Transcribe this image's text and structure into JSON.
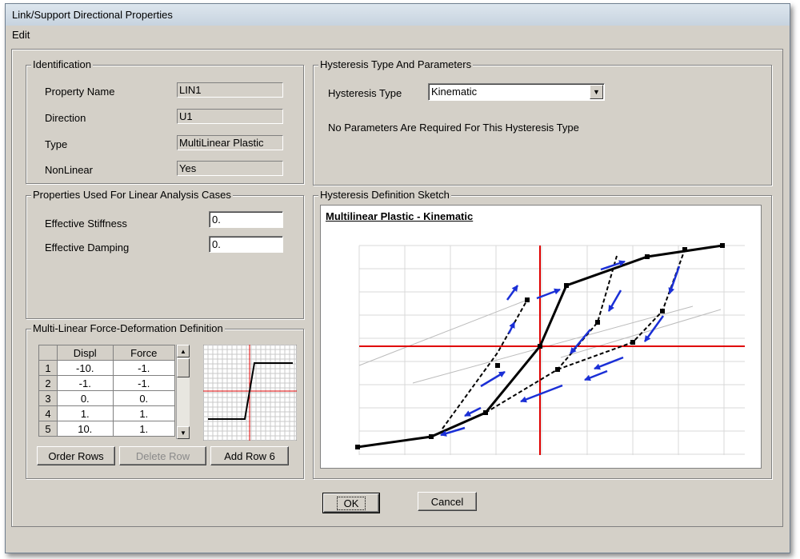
{
  "window": {
    "title": "Link/Support Directional Properties"
  },
  "menu": {
    "items": [
      "Edit"
    ]
  },
  "identification": {
    "title": "Identification",
    "property_name_label": "Property Name",
    "property_name": "LIN1",
    "direction_label": "Direction",
    "direction": "U1",
    "type_label": "Type",
    "type": "MultiLinear Plastic",
    "nonlinear_label": "NonLinear",
    "nonlinear": "Yes"
  },
  "linear": {
    "title": "Properties Used For Linear Analysis Cases",
    "stiffness_label": "Effective Stiffness",
    "stiffness": "0.",
    "damping_label": "Effective Damping",
    "damping": "0."
  },
  "multilinear": {
    "title": "Multi-Linear Force-Deformation Definition",
    "columns": [
      "Displ",
      "Force"
    ],
    "rows": [
      {
        "n": "1",
        "displ": "-10.",
        "force": "-1."
      },
      {
        "n": "2",
        "displ": "-1.",
        "force": "-1."
      },
      {
        "n": "3",
        "displ": "0.",
        "force": "0."
      },
      {
        "n": "4",
        "displ": "1.",
        "force": "1."
      },
      {
        "n": "5",
        "displ": "10.",
        "force": "1."
      }
    ],
    "order_rows": "Order Rows",
    "delete_row": "Delete Row",
    "add_row": "Add Row 6"
  },
  "hysteresis": {
    "title": "Hysteresis Type And Parameters",
    "type_label": "Hysteresis Type",
    "type_value": "Kinematic",
    "note": "No Parameters Are Required For This Hysteresis Type"
  },
  "sketch": {
    "title": "Hysteresis Definition Sketch",
    "heading": "Multilinear Plastic - Kinematic"
  },
  "buttons": {
    "ok": "OK",
    "cancel": "Cancel"
  },
  "colors": {
    "axis": "#e00000",
    "arrow": "#1a2fd6",
    "curve": "#000000",
    "grid": "#d8d8d8"
  }
}
